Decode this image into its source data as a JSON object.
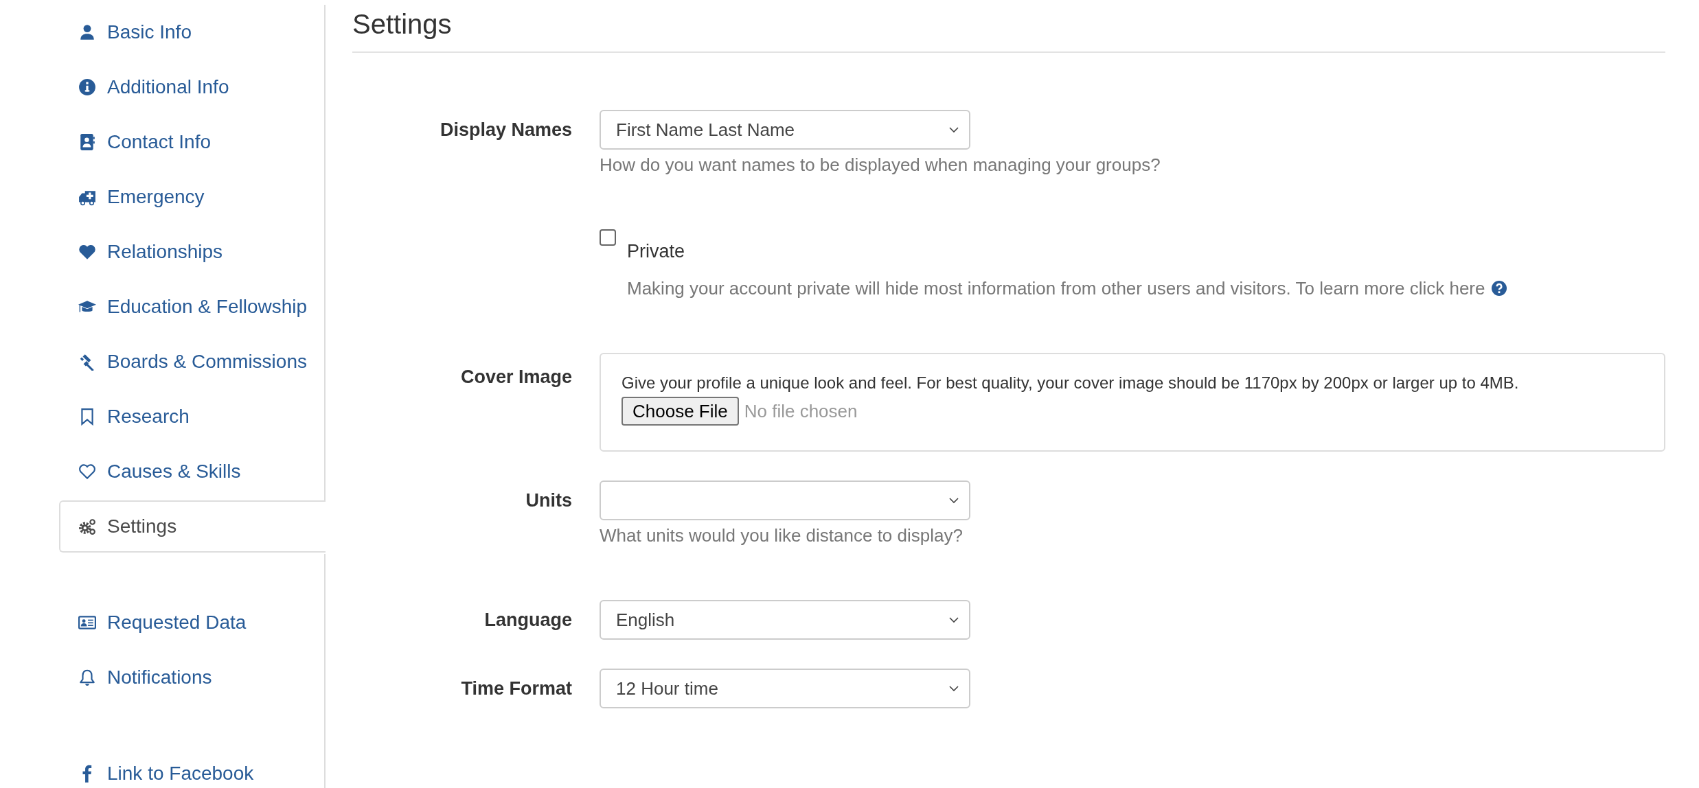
{
  "sidebar": {
    "groups": [
      {
        "items": [
          {
            "label": "Basic Info",
            "selected": false
          },
          {
            "label": "Additional Info",
            "selected": false
          },
          {
            "label": "Contact Info",
            "selected": false
          },
          {
            "label": "Emergency",
            "selected": false
          },
          {
            "label": "Relationships",
            "selected": false
          },
          {
            "label": "Education & Fellowship",
            "selected": false
          },
          {
            "label": "Boards & Commissions",
            "selected": false
          },
          {
            "label": "Research",
            "selected": false
          },
          {
            "label": "Causes & Skills",
            "selected": false
          },
          {
            "label": "Settings",
            "selected": true
          }
        ]
      },
      {
        "items": [
          {
            "label": "Requested Data",
            "selected": false
          },
          {
            "label": "Notifications",
            "selected": false
          }
        ]
      },
      {
        "items": [
          {
            "label": "Link to Facebook",
            "selected": false
          }
        ]
      }
    ]
  },
  "page_title": "Settings",
  "fields": [
    {
      "kind": "select",
      "label": "Display Names",
      "value": "First Name Last Name",
      "help": "How do you want names to be displayed when managing your groups?"
    },
    {
      "kind": "checkbox",
      "label": "Private",
      "checked": false,
      "help": "Making your account private will hide most information from other users and visitors. To learn more click here"
    },
    {
      "kind": "file",
      "label": "Cover Image",
      "description": "Give your profile a unique look and feel. For best quality, your cover image should be 1170px by 200px or larger up to 4MB.",
      "button": "Choose File",
      "status": "No file chosen"
    },
    {
      "kind": "select",
      "label": "Units",
      "help": "What units would you like distance to display?"
    },
    {
      "kind": "select",
      "label": "Language",
      "value": "English"
    },
    {
      "kind": "select",
      "label": "Time Format",
      "value": "12 Hour time"
    }
  ]
}
